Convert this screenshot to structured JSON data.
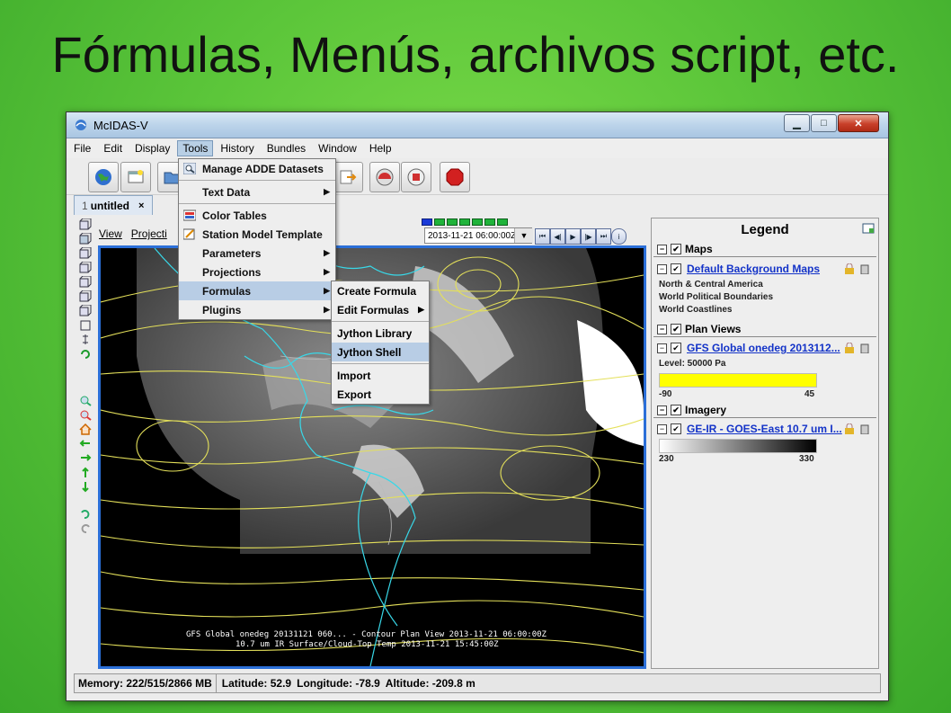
{
  "slide": {
    "title": "Fórmulas, Menús, archivos script, etc."
  },
  "window": {
    "title": "McIDAS-V"
  },
  "menubar": [
    "File",
    "Edit",
    "Display",
    "Tools",
    "History",
    "Bundles",
    "Window",
    "Help"
  ],
  "tab": {
    "number": "1",
    "label": "untitled",
    "close": "×"
  },
  "viewbar": {
    "view": "View",
    "projection": "Projecti"
  },
  "animation": {
    "time": "2013-11-21 06:00:00Z"
  },
  "tools_menu": {
    "items": [
      {
        "label": "Manage ADDE Datasets",
        "icon": "magnifier-icon",
        "submenu": false
      },
      {
        "label": "Text Data",
        "submenu": true
      },
      {
        "label": "Color Tables",
        "icon": "color-table-icon",
        "submenu": false
      },
      {
        "label": "Station Model Template",
        "icon": "station-model-icon",
        "submenu": false
      },
      {
        "label": "Parameters",
        "submenu": true
      },
      {
        "label": "Projections",
        "submenu": true
      },
      {
        "label": "Formulas",
        "submenu": true
      },
      {
        "label": "Plugins",
        "submenu": true
      }
    ]
  },
  "formulas_menu": {
    "items": [
      {
        "label": "Create Formula",
        "submenu": false
      },
      {
        "label": "Edit Formulas",
        "submenu": true
      },
      {
        "label": "Jython Library",
        "submenu": false
      },
      {
        "label": "Jython Shell",
        "submenu": false
      },
      {
        "label": "Import",
        "submenu": false
      },
      {
        "label": "Export",
        "submenu": false
      }
    ]
  },
  "legend": {
    "title": "Legend",
    "maps": {
      "section": "Maps",
      "layer": "Default Background Maps",
      "sublayers": [
        "North & Central America",
        "World Political Boundaries",
        "World Coastlines"
      ]
    },
    "plan_views": {
      "section": "Plan Views",
      "layer": "GFS Global onedeg 2013112...",
      "level": "Level: 50000 Pa",
      "min": "-90",
      "max": "45",
      "bar_color": "#ffff00"
    },
    "imagery": {
      "section": "Imagery",
      "layer": "GE-IR - GOES-East 10.7 um I...",
      "min": "230",
      "max": "330"
    }
  },
  "map_labels": {
    "line1": "GFS Global onedeg 20131121 060... - Contour Plan View 2013-11-21 06:00:00Z",
    "line2": "10.7 um IR Surface/Cloud-Top Temp 2013-11-21 15:45:00Z"
  },
  "status": {
    "memory": "Memory: 222/515/2866 MB",
    "latitude": "Latitude: 52.9",
    "longitude": "Longitude: -78.9",
    "altitude": "Altitude: -209.8 m"
  },
  "colors": {
    "accent": "#2b6fd8",
    "contour": "#e4e05a",
    "coast": "#38d8e8"
  }
}
